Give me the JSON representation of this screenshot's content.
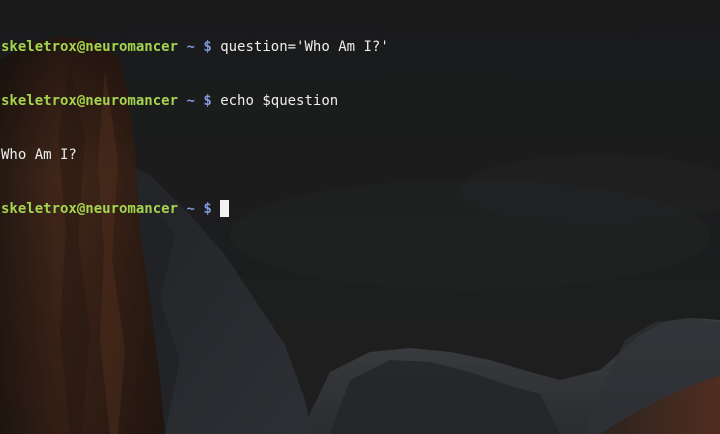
{
  "terminal": {
    "prompt": {
      "user_host": "skeletrox@neuromancer",
      "path": "~",
      "symbol": "$"
    },
    "lines": [
      {
        "type": "command",
        "text": "question='Who Am I?'"
      },
      {
        "type": "command",
        "text": "echo $question"
      },
      {
        "type": "output",
        "text": "Who Am I?"
      },
      {
        "type": "command",
        "text": ""
      }
    ],
    "colors": {
      "background": "#202122",
      "prompt_user": "#a5d44e",
      "prompt_path": "#7f9ad8",
      "text": "#eeeeec",
      "cursor": "#f2f2f2"
    }
  }
}
